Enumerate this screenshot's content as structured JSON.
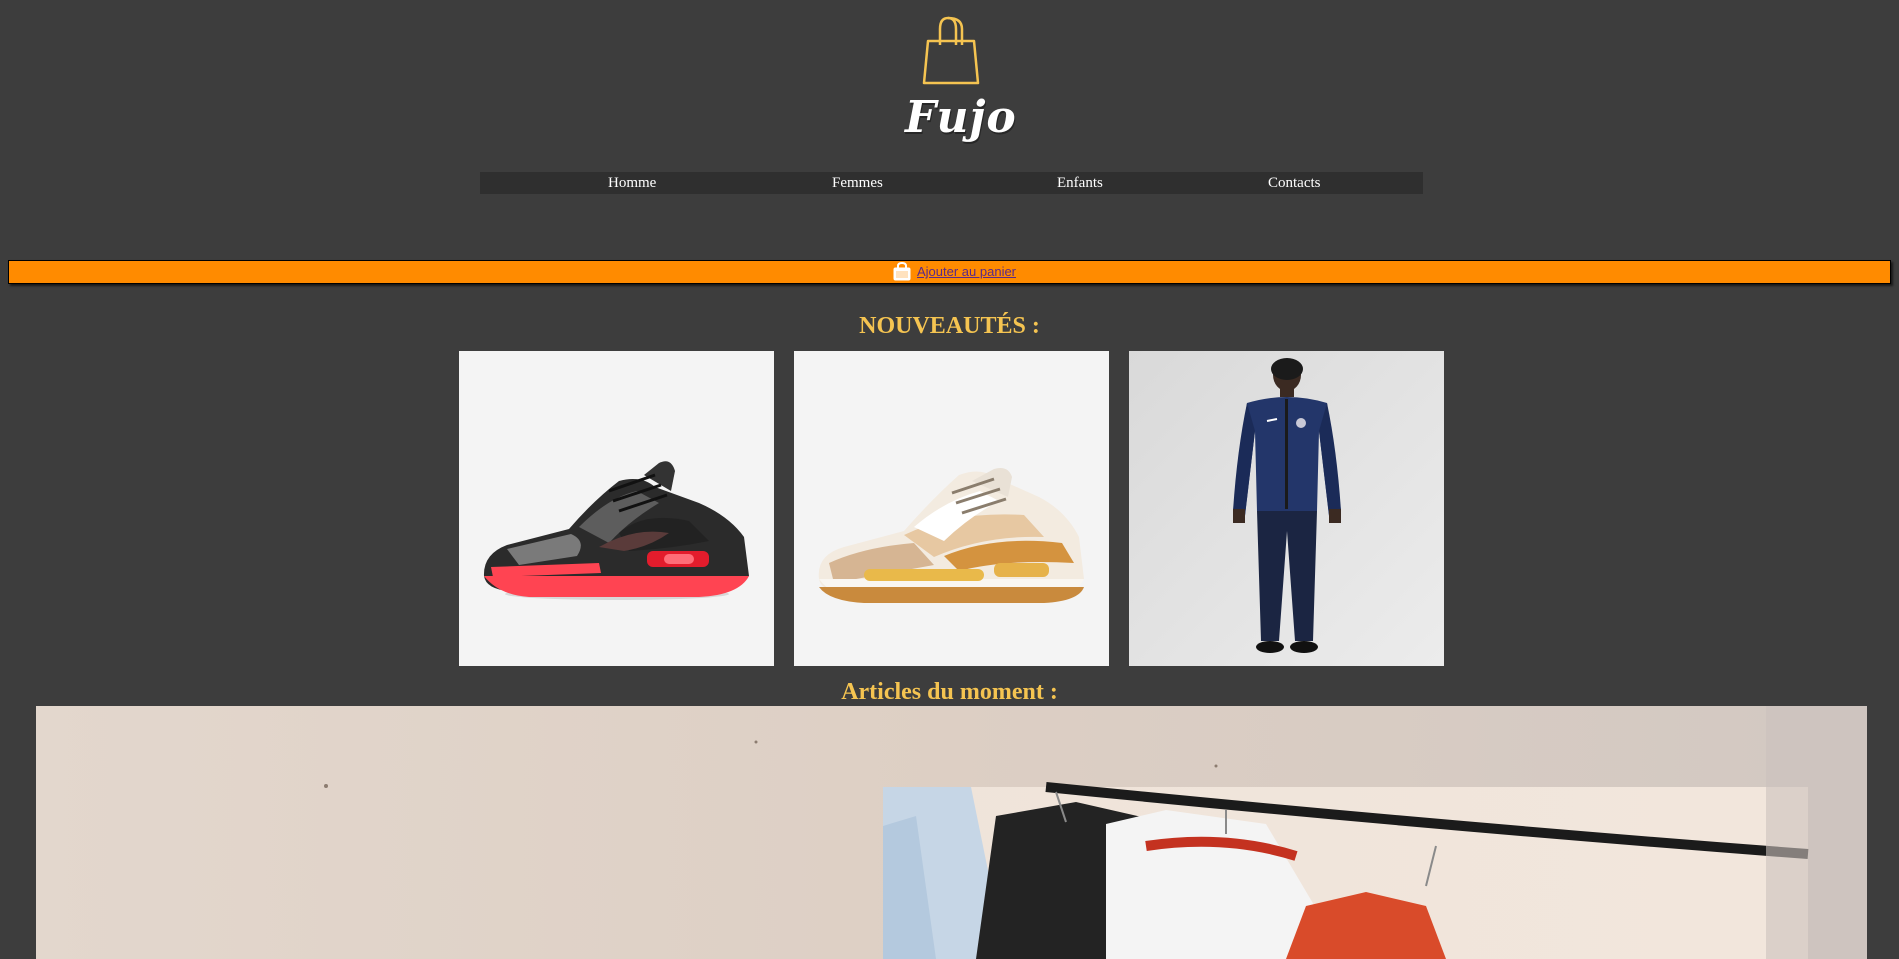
{
  "brand": {
    "name": "Fujo",
    "icon": "shopping-bag-icon"
  },
  "nav": {
    "items": [
      {
        "label": "Homme"
      },
      {
        "label": "Femmes"
      },
      {
        "label": "Enfants"
      },
      {
        "label": "Contacts"
      }
    ]
  },
  "cart": {
    "label": "Ajouter au panier",
    "icon": "shopping-bag-icon"
  },
  "sections": {
    "new_title": "NOUVEAUTÉS :",
    "moment_title": "Articles du moment :"
  },
  "colors": {
    "background": "#3d3d3d",
    "accent_gold": "#f5c451",
    "cart_bar": "#ff8b00",
    "nav_bar": "#2f2f2f"
  }
}
